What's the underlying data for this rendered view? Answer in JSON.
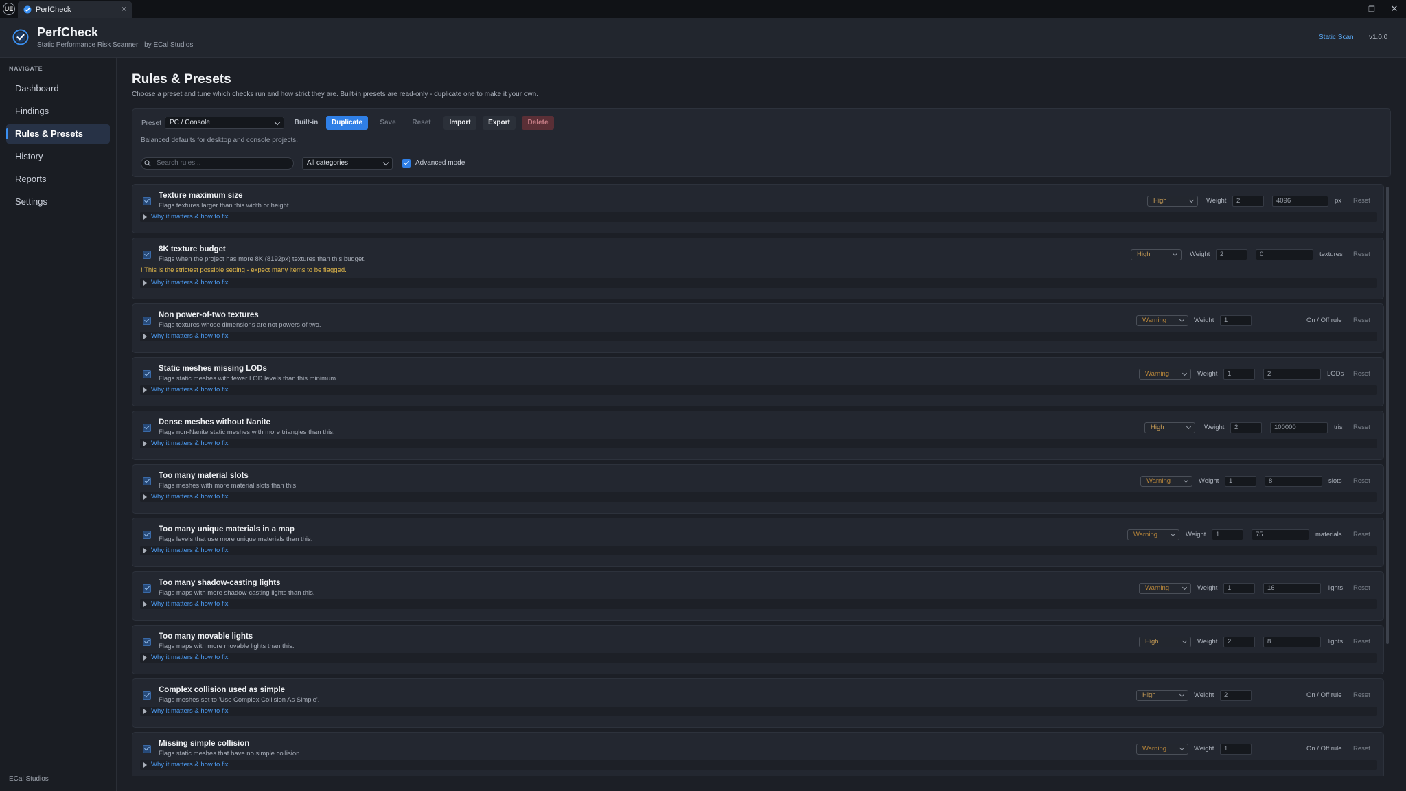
{
  "window": {
    "engine_logo": "UE",
    "tab_title": "PerfCheck",
    "tab_close": "×",
    "controls": [
      "—",
      "❐",
      "✕"
    ]
  },
  "header": {
    "title": "PerfCheck",
    "subtitle": "Static Performance Risk Scanner  ·  by ECal Studios",
    "static_scan": "Static Scan",
    "version": "v1.0.0"
  },
  "sidebar": {
    "caption": "NAVIGATE",
    "items": [
      {
        "label": "Dashboard",
        "active": false
      },
      {
        "label": "Findings",
        "active": false
      },
      {
        "label": "Rules & Presets",
        "active": true
      },
      {
        "label": "History",
        "active": false
      },
      {
        "label": "Reports",
        "active": false
      },
      {
        "label": "Settings",
        "active": false
      }
    ],
    "footer": "ECal Studios"
  },
  "page": {
    "title": "Rules & Presets",
    "subtitle": "Choose a preset and tune which checks run and how strict they are. Built-in presets are read-only - duplicate one to make it your own."
  },
  "toolbar": {
    "preset_label": "Preset",
    "preset_value": "PC / Console",
    "built_in": "Built-in",
    "duplicate": "Duplicate",
    "save": "Save",
    "reset": "Reset",
    "import": "Import",
    "export": "Export",
    "delete": "Delete",
    "preset_description": "Balanced defaults for desktop and console projects.",
    "search_placeholder": "Search rules...",
    "category_value": "All categories",
    "advanced_mode": "Advanced mode"
  },
  "why_label": "Why it matters & how to fix",
  "weight_label": "Weight",
  "reset_label": "Reset",
  "rules": [
    {
      "title": "Texture maximum size",
      "desc": "Flags textures larger than this width or height.",
      "severity": "High",
      "weight": "2",
      "threshold": "4096",
      "unit": "px"
    },
    {
      "title": "8K texture budget",
      "desc": "Flags when the project has more 8K (8192px) textures than this budget.",
      "severity": "High",
      "weight": "2",
      "threshold": "0",
      "unit": "textures",
      "warning": "! This is the strictest possible setting - expect many items to be flagged."
    },
    {
      "title": "Non power-of-two textures",
      "desc": "Flags textures whose dimensions are not powers of two.",
      "severity": "Warning",
      "weight": "1",
      "unit": "On / Off rule"
    },
    {
      "title": "Static meshes missing LODs",
      "desc": "Flags static meshes with fewer LOD levels than this minimum.",
      "severity": "Warning",
      "weight": "1",
      "threshold": "2",
      "unit": "LODs"
    },
    {
      "title": "Dense meshes without Nanite",
      "desc": "Flags non-Nanite static meshes with more triangles than this.",
      "severity": "High",
      "weight": "2",
      "threshold": "100000",
      "unit": "tris"
    },
    {
      "title": "Too many material slots",
      "desc": "Flags meshes with more material slots than this.",
      "severity": "Warning",
      "weight": "1",
      "threshold": "8",
      "unit": "slots"
    },
    {
      "title": "Too many unique materials in a map",
      "desc": "Flags levels that use more unique materials than this.",
      "severity": "Warning",
      "weight": "1",
      "threshold": "75",
      "unit": "materials"
    },
    {
      "title": "Too many shadow-casting lights",
      "desc": "Flags maps with more shadow-casting lights than this.",
      "severity": "Warning",
      "weight": "1",
      "threshold": "16",
      "unit": "lights"
    },
    {
      "title": "Too many movable lights",
      "desc": "Flags maps with more movable lights than this.",
      "severity": "High",
      "weight": "2",
      "threshold": "8",
      "unit": "lights"
    },
    {
      "title": "Complex collision used as simple",
      "desc": "Flags meshes set to 'Use Complex Collision As Simple'.",
      "severity": "High",
      "weight": "2",
      "unit": "On / Off rule"
    },
    {
      "title": "Missing simple collision",
      "desc": "Flags static meshes that have no simple collision.",
      "severity": "Warning",
      "weight": "1",
      "unit": "On / Off rule"
    }
  ]
}
